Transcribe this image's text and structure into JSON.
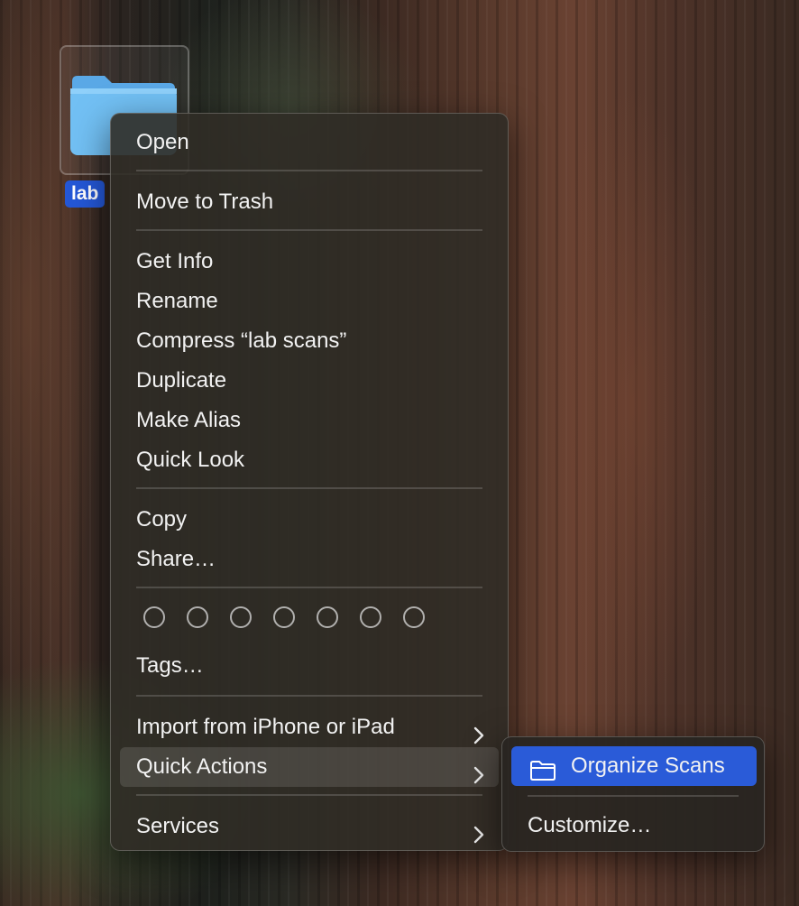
{
  "desktop": {
    "folder_label": "lab",
    "accent_color": "#2457d6"
  },
  "context_menu": {
    "groups": [
      [
        "Open"
      ],
      [
        "Move to Trash"
      ],
      [
        "Get Info",
        "Rename",
        "Compress “lab scans”",
        "Duplicate",
        "Make Alias",
        "Quick Look"
      ],
      [
        "Copy",
        "Share…"
      ],
      [
        "Tags…"
      ],
      [
        "Import from iPhone or iPad",
        "Quick Actions"
      ],
      [
        "Services"
      ]
    ],
    "open": "Open",
    "move_to_trash": "Move to Trash",
    "get_info": "Get Info",
    "rename": "Rename",
    "compress": "Compress “lab scans”",
    "duplicate": "Duplicate",
    "make_alias": "Make Alias",
    "quick_look": "Quick Look",
    "copy": "Copy",
    "share": "Share…",
    "tags": "Tags…",
    "import_iphone": "Import from iPhone or iPad",
    "quick_actions": "Quick Actions",
    "services": "Services",
    "tag_colors_count": 7,
    "highlighted_item": "Quick Actions"
  },
  "quick_actions_submenu": {
    "organize_scans": "Organize Scans",
    "customize": "Customize…",
    "selected_color": "#2a5bd8",
    "icon": "folder-icon"
  }
}
